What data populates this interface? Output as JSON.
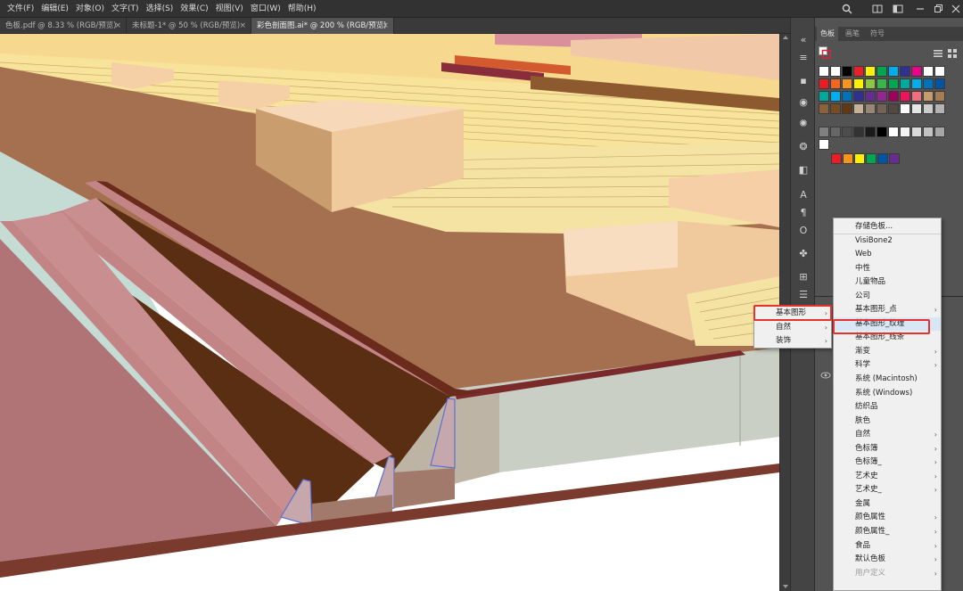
{
  "menubar": {
    "items": [
      "文件(F)",
      "编辑(E)",
      "对象(O)",
      "文字(T)",
      "选择(S)",
      "效果(C)",
      "视图(V)",
      "窗口(W)",
      "帮助(H)"
    ]
  },
  "tabs": [
    {
      "label": "色板.pdf @ 8.33 % (RGB/预览)"
    },
    {
      "label": "未标题-1* @ 50 % (RGB/预览)"
    },
    {
      "label": "彩色剖面图.ai* @ 200 % (RGB/预览)"
    }
  ],
  "panel": {
    "tabs": [
      "色板",
      "画笔",
      "符号"
    ]
  },
  "swatch_rows": [
    [
      "#ffffff",
      "#ffffff",
      "#000000",
      "#e8202a",
      "#fff200",
      "#00a651",
      "#00aeef",
      "#2e3192",
      "#ec008c",
      "#ffffff",
      "#ffffff"
    ],
    [
      "#ed1c24",
      "#f26522",
      "#f7941d",
      "#fff200",
      "#8dc63f",
      "#39b54a",
      "#00a651",
      "#00a99d",
      "#00aeef",
      "#0072bc",
      "#0054a6"
    ],
    [
      "#00a99d",
      "#00aeef",
      "#0072bc",
      "#2e3192",
      "#662d91",
      "#92278f",
      "#9e005d",
      "#ed145b",
      "#f26d7d",
      "#c69c6d",
      "#a67c52"
    ],
    [
      "#8c6239",
      "#754c24",
      "#603913",
      "#c7b299",
      "#998675",
      "#736357",
      "#534741",
      "#ffffff",
      "#e6e6e6",
      "#cccccc",
      "#b3b3b3"
    ],
    [
      "#808080",
      "#666666",
      "#4d4d4d",
      "#333333",
      "#1a1a1a",
      "#000000",
      "#ffffff",
      "#f2f2f2",
      "#d9d9d9",
      "#c2c2c2",
      "#a6a6a6"
    ],
    [
      "#ffffff"
    ],
    [
      "#ed1c24",
      "#f7941d",
      "#fff200",
      "#00a651",
      "#0054a6",
      "#662d91"
    ]
  ],
  "ctx_menu_1": {
    "items": [
      "基本图形",
      "自然",
      "装饰"
    ]
  },
  "ctx_menu_2": {
    "items": [
      {
        "label": "存储色板..."
      },
      {
        "label": "VisiBone2"
      },
      {
        "label": "Web"
      },
      {
        "label": "中性"
      },
      {
        "label": "儿童物品"
      },
      {
        "label": "公司"
      },
      {
        "label": "基本图形_点",
        "sub": true
      },
      {
        "label": "基本图形_纹理",
        "highlighted": true
      },
      {
        "label": "基本图形_线条"
      },
      {
        "label": "渐变",
        "sub": true
      },
      {
        "label": "科学",
        "sub": true
      },
      {
        "label": "系统 (Macintosh)"
      },
      {
        "label": "系统 (Windows)"
      },
      {
        "label": "纺织品"
      },
      {
        "label": "肤色"
      },
      {
        "label": "自然",
        "sub": true
      },
      {
        "label": "色标簿",
        "sub": true
      },
      {
        "label": "色标簿_",
        "sub": true
      },
      {
        "label": "艺术史",
        "sub": true
      },
      {
        "label": "艺术史_",
        "sub": true
      },
      {
        "label": "金属"
      },
      {
        "label": "颜色属性",
        "sub": true
      },
      {
        "label": "颜色属性_",
        "sub": true
      },
      {
        "label": "食品",
        "sub": true
      },
      {
        "label": "默认色板",
        "sub": true
      },
      {
        "label": "用户定义",
        "sub": true,
        "disabled": true
      }
    ]
  },
  "colors": {
    "accent_red": "#e8312a",
    "chrome_dark": "#323232",
    "panel_bg": "#535353"
  }
}
